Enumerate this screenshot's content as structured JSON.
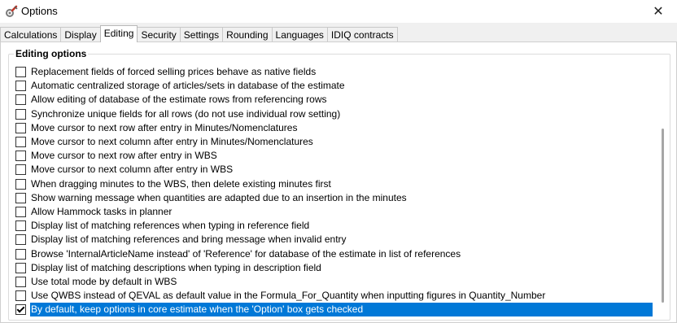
{
  "window": {
    "title": "Options",
    "icon": "wrench-gear-icon",
    "close_label": "✕"
  },
  "tabs": [
    {
      "label": "Calculations",
      "active": false
    },
    {
      "label": "Display",
      "active": false
    },
    {
      "label": "Editing",
      "active": true
    },
    {
      "label": "Security",
      "active": false
    },
    {
      "label": "Settings",
      "active": false
    },
    {
      "label": "Rounding",
      "active": false
    },
    {
      "label": "Languages",
      "active": false
    },
    {
      "label": "IDIQ contracts",
      "active": false
    }
  ],
  "group": {
    "title": "Editing options"
  },
  "options": [
    {
      "label": "Replacement fields of forced selling prices behave as native fields",
      "checked": false,
      "selected": false
    },
    {
      "label": "Automatic centralized storage of articles/sets in database of the estimate",
      "checked": false,
      "selected": false
    },
    {
      "label": "Allow editing of database of the estimate rows from referencing rows",
      "checked": false,
      "selected": false
    },
    {
      "label": "Synchronize unique fields for all rows (do not use individual row setting)",
      "checked": false,
      "selected": false
    },
    {
      "label": "Move cursor to next row after entry in Minutes/Nomenclatures",
      "checked": false,
      "selected": false
    },
    {
      "label": "Move cursor to next column after entry in Minutes/Nomenclatures",
      "checked": false,
      "selected": false
    },
    {
      "label": "Move cursor to next row after entry in WBS",
      "checked": false,
      "selected": false
    },
    {
      "label": "Move cursor to next column after entry in WBS",
      "checked": false,
      "selected": false
    },
    {
      "label": "When dragging minutes to the WBS, then delete existing minutes first",
      "checked": false,
      "selected": false
    },
    {
      "label": "Show warning message when quantities are adapted due to an insertion in the minutes",
      "checked": false,
      "selected": false
    },
    {
      "label": "Allow Hammock tasks in planner",
      "checked": false,
      "selected": false
    },
    {
      "label": "Display list of matching references when typing in reference field",
      "checked": false,
      "selected": false
    },
    {
      "label": "Display list of matching references and bring message when invalid entry",
      "checked": false,
      "selected": false
    },
    {
      "label": "Browse 'InternalArticleName instead' of 'Reference' for database of the estimate in list of references",
      "checked": false,
      "selected": false
    },
    {
      "label": "Display list of matching descriptions when typing in description field",
      "checked": false,
      "selected": false
    },
    {
      "label": "Use total mode by default in WBS",
      "checked": false,
      "selected": false
    },
    {
      "label": "Use QWBS instead of QEVAL as default value in the Formula_For_Quantity when inputting figures in Quantity_Number",
      "checked": false,
      "selected": false
    },
    {
      "label": "By default, keep options in core estimate when the 'Option' box gets checked",
      "checked": true,
      "selected": true
    }
  ],
  "colors": {
    "selection": "#0078d7",
    "background": "#f0f0f0"
  }
}
